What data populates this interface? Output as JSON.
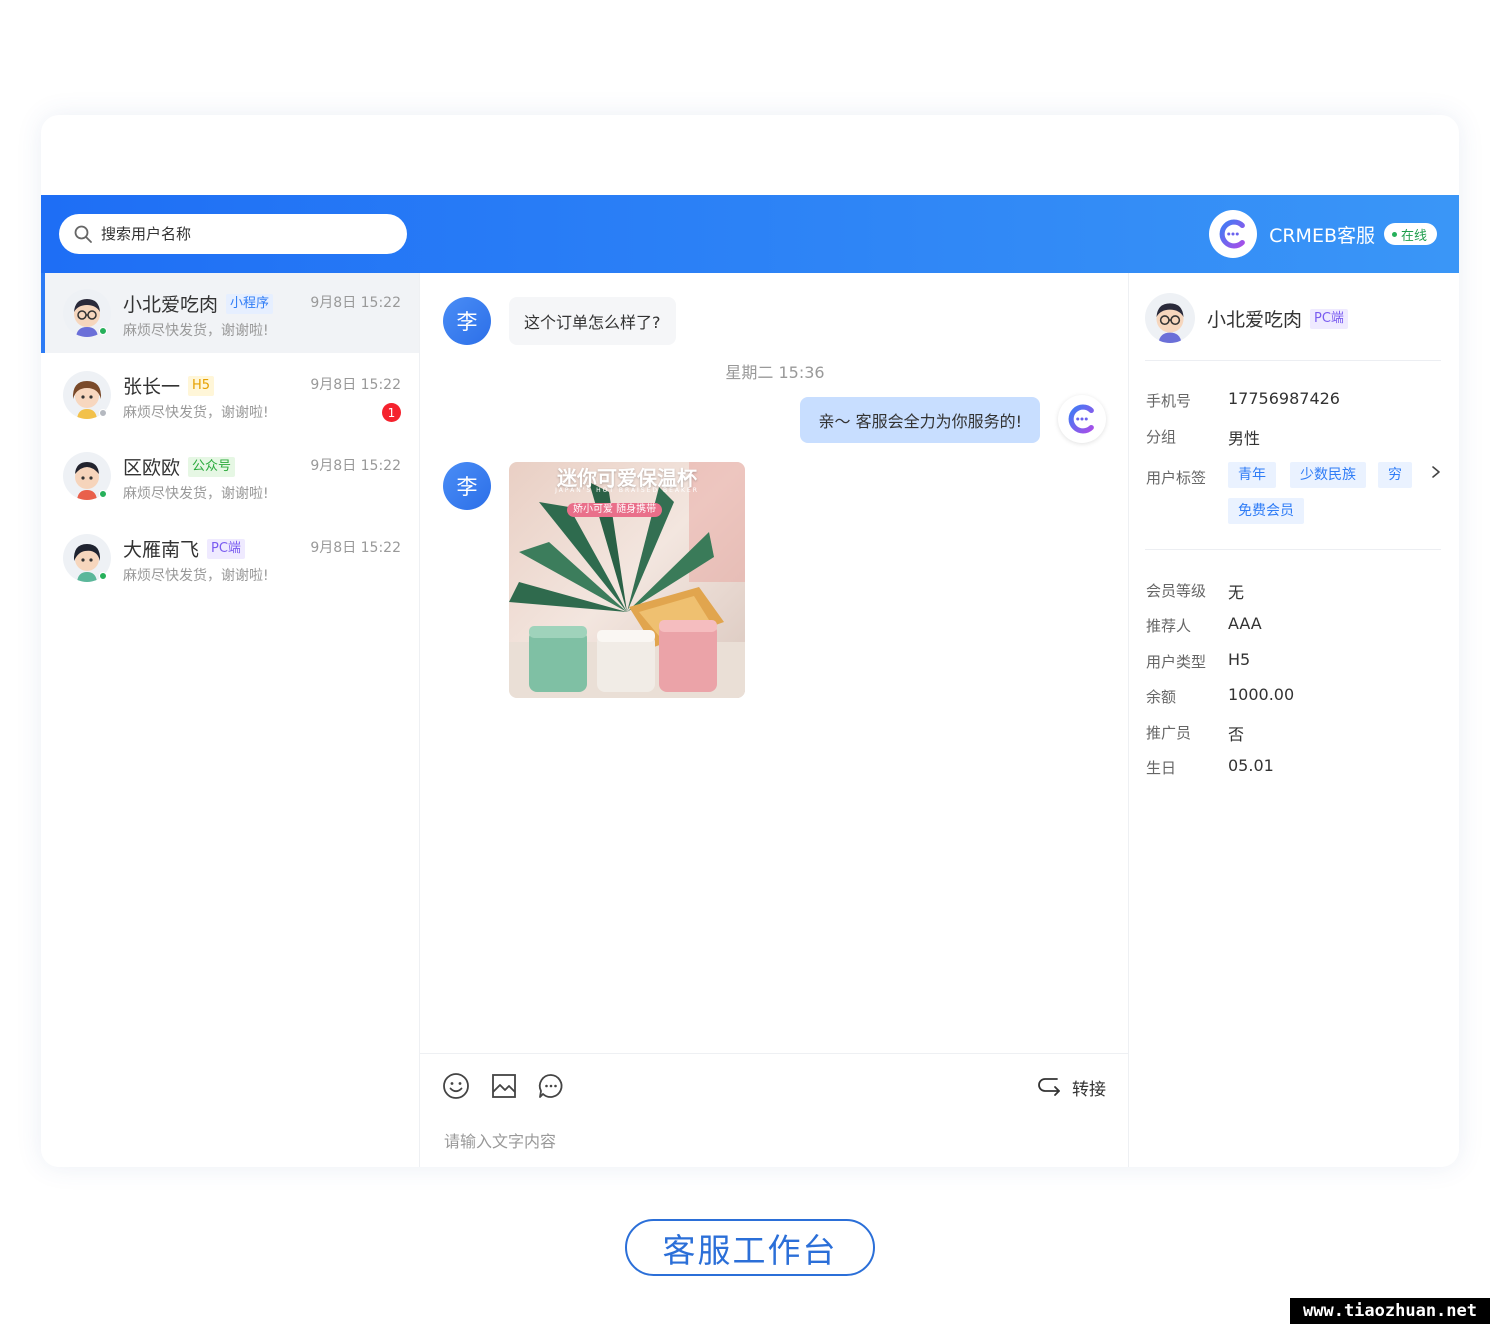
{
  "search": {
    "placeholder": "搜索用户名称"
  },
  "brand": {
    "name": "CRMEB客服",
    "status": "在线"
  },
  "conversations": [
    {
      "name": "小北爱吃肉",
      "tag": "小程序",
      "message": "麻烦尽快发货，谢谢啦!",
      "time": "9月8日 15:22",
      "unread": "",
      "active": true,
      "online": true
    },
    {
      "name": "张长一",
      "tag": "H5",
      "message": "麻烦尽快发货，谢谢啦!",
      "time": "9月8日 15:22",
      "unread": "1",
      "active": false,
      "online": false
    },
    {
      "name": "区欧欧",
      "tag": "公众号",
      "message": "麻烦尽快发货，谢谢啦!",
      "time": "9月8日 15:22",
      "unread": "",
      "active": false,
      "online": true
    },
    {
      "name": "大雁南飞",
      "tag": "PC端",
      "message": "麻烦尽快发货，谢谢啦!",
      "time": "9月8日 15:22",
      "unread": "",
      "active": false,
      "online": true
    }
  ],
  "chat": {
    "user_initial": "李",
    "message_in": "这个订单怎么样了?",
    "timestamp": "星期二 15:36",
    "message_out": "亲～ 客服会全力为你服务的!",
    "image": {
      "title": "迷你可爱保温杯",
      "subtitle": "JAPAN'S HOT BRAISED BEAKER",
      "tag": "娇小可爱 随身携带"
    }
  },
  "composer": {
    "transfer_label": "转接",
    "placeholder": "请输入文字内容"
  },
  "profile": {
    "name": "小北爱吃肉",
    "tag": "PC端",
    "phone_label": "手机号",
    "phone": "17756987426",
    "group_label": "分组",
    "group": "男性",
    "tags_label": "用户标签",
    "tags": [
      "青年",
      "少数民族",
      "穷",
      "免费会员"
    ],
    "level_label": "会员等级",
    "level": "无",
    "referrer_label": "推荐人",
    "referrer": "AAA",
    "type_label": "用户类型",
    "type": "H5",
    "balance_label": "余额",
    "balance": "1000.00",
    "promoter_label": "推广员",
    "promoter": "否",
    "birthday_label": "生日",
    "birthday": "05.01"
  },
  "footer": {
    "title": "客服工作台"
  },
  "watermark": "www.tiaozhuan.net",
  "colors": {
    "primary": "#1e6ef5",
    "online": "#26b05a",
    "unread": "#f5222d"
  }
}
